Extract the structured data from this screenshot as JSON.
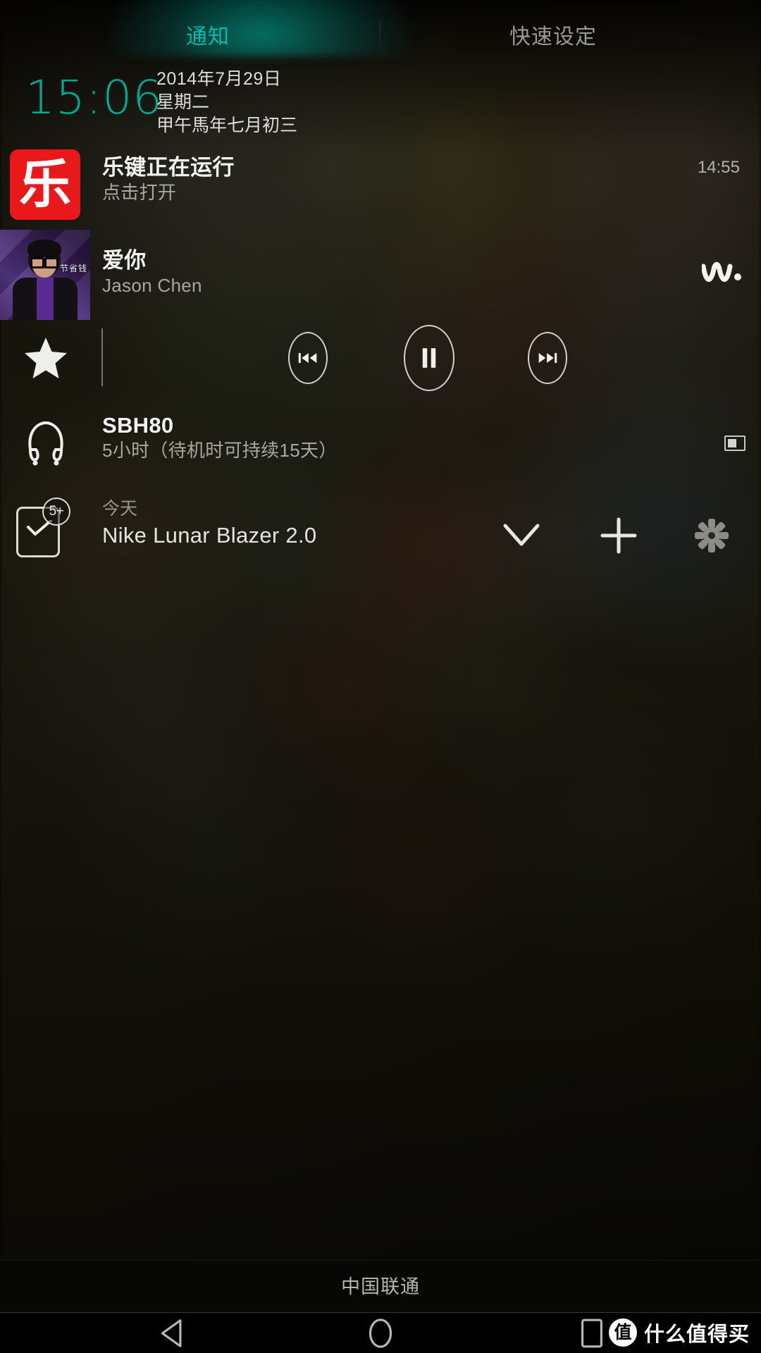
{
  "status_bar": {
    "tab_glow_color": "#00bfae"
  },
  "tabs": [
    {
      "id": "notifications",
      "label": "通知",
      "active": true,
      "color": "#00bfae"
    },
    {
      "id": "quick_settings",
      "label": "快速设定",
      "active": false,
      "color": "#9a9a93"
    }
  ],
  "clock": {
    "time": "15:06",
    "color": "#00a896",
    "date_gregorian": "2014年7月29日",
    "weekday": "星期二",
    "date_lunar": "甲午馬年七月初三"
  },
  "notifications": [
    {
      "id": "lejian-service",
      "icon": "app-icon-lejian",
      "icon_glyph": "乐",
      "icon_color": "#e8181b",
      "title": "乐键正在运行",
      "subtitle": "点击打开",
      "time": "14:55"
    },
    {
      "id": "music-player",
      "icon": "album-art",
      "title": "爱你",
      "subtitle": "Jason Chen",
      "album_art_watermark": "节省钱",
      "brand_icon": "walkman-logo",
      "controls": [
        {
          "id": "favorite",
          "icon": "star-icon",
          "label": "收藏"
        },
        {
          "id": "previous",
          "icon": "skip-previous-icon",
          "label": "上一首"
        },
        {
          "id": "pause",
          "icon": "pause-icon",
          "label": "暂停"
        },
        {
          "id": "next",
          "icon": "skip-next-icon",
          "label": "下一首"
        }
      ]
    },
    {
      "id": "headset-battery",
      "icon": "headset-icon",
      "title": "SBH80",
      "subtitle": "5小时（待机时可持续15天）",
      "battery_icon": "battery-icon"
    },
    {
      "id": "task-reminder",
      "icon": "checkbox-icon",
      "badge": "5+",
      "label": "今天",
      "title": "Nike Lunar Blazer 2.0",
      "actions": [
        {
          "id": "expand",
          "icon": "chevron-down-icon"
        },
        {
          "id": "add",
          "icon": "plus-icon"
        },
        {
          "id": "settings",
          "icon": "gear-icon"
        }
      ]
    }
  ],
  "carrier": {
    "name": "中国联通"
  },
  "nav_bar": [
    {
      "id": "back",
      "icon": "back-triangle-icon"
    },
    {
      "id": "home",
      "icon": "home-circle-icon"
    },
    {
      "id": "recents",
      "icon": "recents-square-icon"
    }
  ],
  "watermark": {
    "logo_glyph": "值",
    "text": "什么值得买"
  }
}
